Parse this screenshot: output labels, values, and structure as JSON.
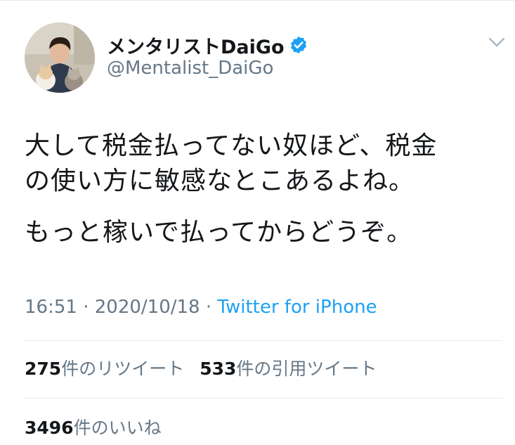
{
  "user": {
    "display_name": "メンタリストDaiGo",
    "handle": "@Mentalist_DaiGo",
    "verified": true
  },
  "tweet": {
    "lines": [
      "大して税金払ってない奴ほど、税金",
      "の使い方に敏感なとこあるよね。",
      "もっと稼いで払ってからどうぞ。"
    ],
    "time": "16:51",
    "separator": " · ",
    "date": "2020/10/18",
    "source": "Twitter for iPhone"
  },
  "stats": {
    "retweets_count": "275",
    "retweets_label": "件のリツイート",
    "quotes_count": "533",
    "quotes_label": "件の引用ツイート",
    "likes_count": "3496",
    "likes_label": "件のいいね"
  },
  "colors": {
    "text": "#14171a",
    "secondary": "#657786",
    "accent": "#1da1f2",
    "divider": "#e6ecf0"
  },
  "icons": {
    "verified": "verified-badge-icon",
    "caret": "chevron-down-icon"
  }
}
